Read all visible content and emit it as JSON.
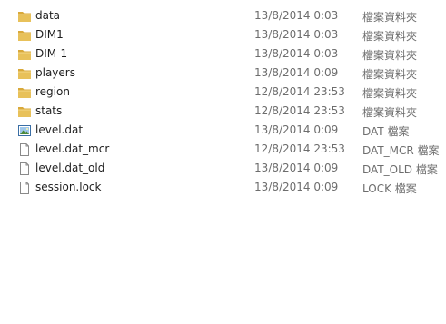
{
  "colors": {
    "folder": "#e8c15a",
    "folder_dark": "#d9a93a",
    "name_text": "#1e1e1e",
    "meta_text": "#6d6d6d"
  },
  "files": [
    {
      "name": "data",
      "date": "13/8/2014 0:03",
      "type": "檔案資料夾",
      "icon": "folder-icon"
    },
    {
      "name": "DIM1",
      "date": "13/8/2014 0:03",
      "type": "檔案資料夾",
      "icon": "folder-icon"
    },
    {
      "name": "DIM-1",
      "date": "13/8/2014 0:03",
      "type": "檔案資料夾",
      "icon": "folder-icon"
    },
    {
      "name": "players",
      "date": "13/8/2014 0:09",
      "type": "檔案資料夾",
      "icon": "folder-icon"
    },
    {
      "name": "region",
      "date": "12/8/2014 23:53",
      "type": "檔案資料夾",
      "icon": "folder-icon"
    },
    {
      "name": "stats",
      "date": "12/8/2014 23:53",
      "type": "檔案資料夾",
      "icon": "folder-icon"
    },
    {
      "name": "level.dat",
      "date": "13/8/2014 0:09",
      "type": "DAT 檔案",
      "icon": "image-file-icon"
    },
    {
      "name": "level.dat_mcr",
      "date": "12/8/2014 23:53",
      "type": "DAT_MCR 檔案",
      "icon": "blank-file-icon"
    },
    {
      "name": "level.dat_old",
      "date": "13/8/2014 0:09",
      "type": "DAT_OLD 檔案",
      "icon": "blank-file-icon"
    },
    {
      "name": "session.lock",
      "date": "13/8/2014 0:09",
      "type": "LOCK 檔案",
      "icon": "blank-file-icon"
    }
  ]
}
